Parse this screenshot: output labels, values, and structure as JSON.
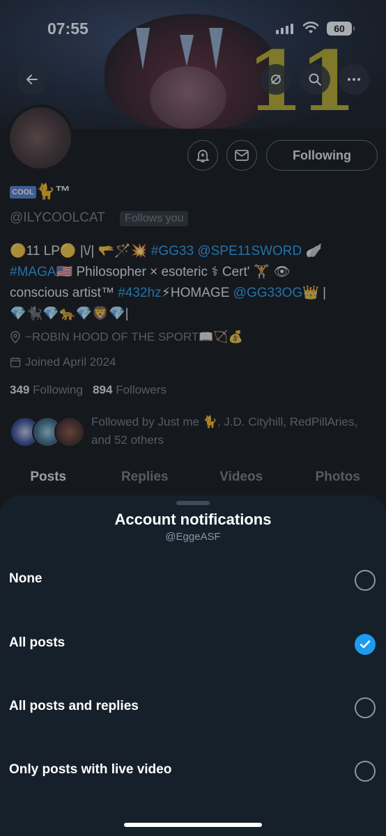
{
  "status_bar": {
    "time": "07:55",
    "battery": "60"
  },
  "banner": {
    "overlay_text": "11"
  },
  "profile": {
    "name_text": "🐈™",
    "name_badge": "COOL",
    "handle": "@ILYCOOLCAT",
    "follows_you": "Follows you",
    "following_button": "Following",
    "bio": {
      "line1_a": "🟡11 LP🟡 |\\/| 🫳🪄💥 ",
      "line1_link1": "#GG33",
      "line1_link2": "@SPE11SWORD",
      "line1_b": " 🪽",
      "line2_link": "#MAGA",
      "line2_b": "🇺🇸 Philosopher × esoteric ⚕ Cert' 🏋 👁",
      "line3_a": "conscious artist™ ",
      "line3_link": "#432hz",
      "line3_b": "⚡HOMAGE ",
      "line3_link2": "@GG33OG",
      "line3_c": "👑 |",
      "line4": "💎🐈‍⬛💎🐆💎🦁💎|"
    },
    "location": "~ROBIN HOOD OF THE SPORT📖🏹💰",
    "joined": "Joined April 2024",
    "following_count": "349",
    "following_label": "Following",
    "followers_count": "894",
    "followers_label": "Followers",
    "followed_by": "Followed by Just me 🐈, J.D. Cityhill, RedPillAries, and 52 others"
  },
  "tabs": [
    "Posts",
    "Replies",
    "Videos",
    "Photos"
  ],
  "sheet": {
    "title": "Account notifications",
    "subtitle": "@EggeASF",
    "options": [
      {
        "label": "None",
        "selected": false
      },
      {
        "label": "All posts",
        "selected": true
      },
      {
        "label": "All posts and replies",
        "selected": false
      },
      {
        "label": "Only posts with live video",
        "selected": false
      }
    ]
  },
  "colors": {
    "accent": "#1d9bf0",
    "sheet_bg": "#15202b",
    "muted": "#71767b"
  },
  "icons": [
    "back-arrow-icon",
    "repost-icon",
    "search-icon",
    "more-icon",
    "bell-icon",
    "mail-icon",
    "location-icon",
    "calendar-icon",
    "checkmark-icon"
  ]
}
